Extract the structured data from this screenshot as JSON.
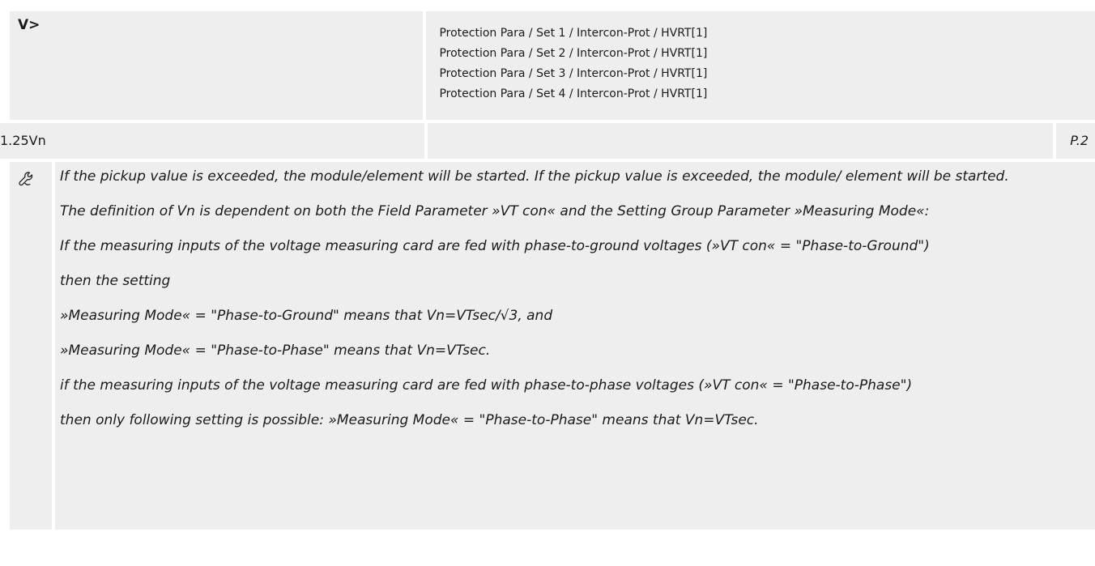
{
  "header": {
    "parameter": "V>",
    "paths": [
      "Protection Para / Set 1 / Intercon-Prot / HVRT[1]",
      "Protection Para / Set 2 / Intercon-Prot / HVRT[1]",
      "Protection Para / Set 3 / Intercon-Prot / HVRT[1]",
      "Protection Para / Set 4 / Intercon-Prot / HVRT[1]"
    ]
  },
  "value_row": {
    "default_value": "1.25Vn",
    "page_ref": "P.2"
  },
  "description": {
    "icon": "wrench-icon",
    "paragraphs": [
      "If the pickup value is exceeded, the module/element will be started. If the pickup value is exceeded, the module/ element will be started.",
      "The definition of Vn is dependent on both the Field Parameter »VT con« and the Setting Group Parameter »Measuring Mode«:",
      "If the measuring inputs of the voltage measuring card are fed with phase-to-ground voltages (»VT con« = \"Phase-to-Ground\")",
      "then the setting",
      "»Measuring Mode« = \"Phase-to-Ground\" means that Vn=VTsec/√3, and",
      "»Measuring Mode« = \"Phase-to-Phase\" means that Vn=VTsec.",
      "if the measuring inputs of the voltage measuring card are fed with phase-to-phase voltages (»VT con« = \"Phase-to-Phase\")",
      "then only following setting is possible: »Measuring Mode« = \"Phase-to-Phase\" means that Vn=VTsec."
    ]
  }
}
